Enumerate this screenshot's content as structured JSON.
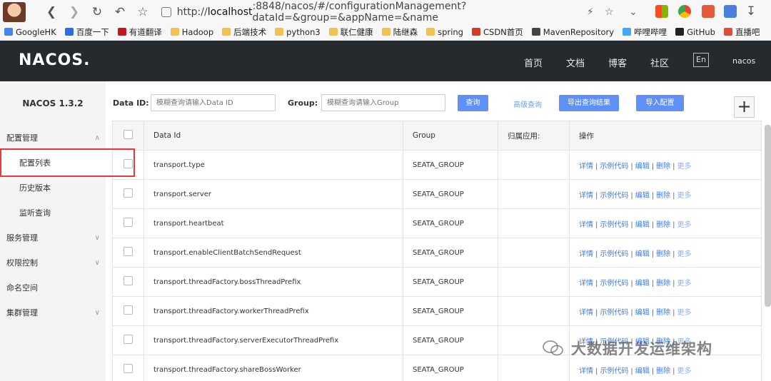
{
  "browser": {
    "url_prefix": "http://",
    "url_host": "localhost",
    "url_rest": ":8848/nacos/#/configurationManagement?dataId=&group=&appName=&name",
    "bookmarks": [
      "GoogleHK",
      "百度一下",
      "有道翻译",
      "Hadoop",
      "后端技术",
      "python3",
      "联仁健康",
      "陆继森",
      "spring",
      "CSDN首页",
      "MavenRepository",
      "哔哩哔哩",
      "GitHub",
      "直播吧"
    ]
  },
  "header": {
    "logo": "NACOS.",
    "nav": [
      "首页",
      "文档",
      "博客",
      "社区"
    ],
    "lang": "En",
    "user": "nacos"
  },
  "sidebar": {
    "version": "NACOS 1.3.2",
    "items": [
      {
        "label": "配置管理",
        "type": "group",
        "chevron": "^"
      },
      {
        "label": "配置列表",
        "type": "sub",
        "active": true
      },
      {
        "label": "历史版本",
        "type": "sub"
      },
      {
        "label": "监听查询",
        "type": "sub"
      },
      {
        "label": "服务管理",
        "type": "group",
        "chevron": "v"
      },
      {
        "label": "权限控制",
        "type": "group",
        "chevron": "v"
      },
      {
        "label": "命名空间",
        "type": "plain"
      },
      {
        "label": "集群管理",
        "type": "group",
        "chevron": "v"
      }
    ]
  },
  "filters": {
    "data_id_label": "Data ID:",
    "data_id_placeholder": "模糊查询请输入Data ID",
    "group_label": "Group:",
    "group_placeholder": "模糊查询请输入Group",
    "search_button": "查询",
    "advanced_link": "高级查询",
    "export_button": "导出查询结果",
    "import_button": "导入配置",
    "add_button": "+"
  },
  "table": {
    "columns": [
      "Data Id",
      "Group",
      "归属应用:",
      "操作"
    ],
    "actions": [
      "详情",
      "示例代码",
      "编辑",
      "删除",
      "更多"
    ],
    "rows": [
      {
        "data_id": "transport.type",
        "group": "SEATA_GROUP",
        "app": ""
      },
      {
        "data_id": "transport.server",
        "group": "SEATA_GROUP",
        "app": ""
      },
      {
        "data_id": "transport.heartbeat",
        "group": "SEATA_GROUP",
        "app": ""
      },
      {
        "data_id": "transport.enableClientBatchSendRequest",
        "group": "SEATA_GROUP",
        "app": ""
      },
      {
        "data_id": "transport.threadFactory.bossThreadPrefix",
        "group": "SEATA_GROUP",
        "app": ""
      },
      {
        "data_id": "transport.threadFactory.workerThreadPrefix",
        "group": "SEATA_GROUP",
        "app": ""
      },
      {
        "data_id": "transport.threadFactory.serverExecutorThreadPrefix",
        "group": "SEATA_GROUP",
        "app": ""
      },
      {
        "data_id": "transport.threadFactory.shareBossWorker",
        "group": "SEATA_GROUP",
        "app": ""
      }
    ]
  },
  "watermark": "大数据开发运维架构",
  "colors": {
    "header_bg": "#252a2f",
    "primary": "#5f90f6",
    "link": "#3d7ce0",
    "highlight": "#e8393f"
  }
}
